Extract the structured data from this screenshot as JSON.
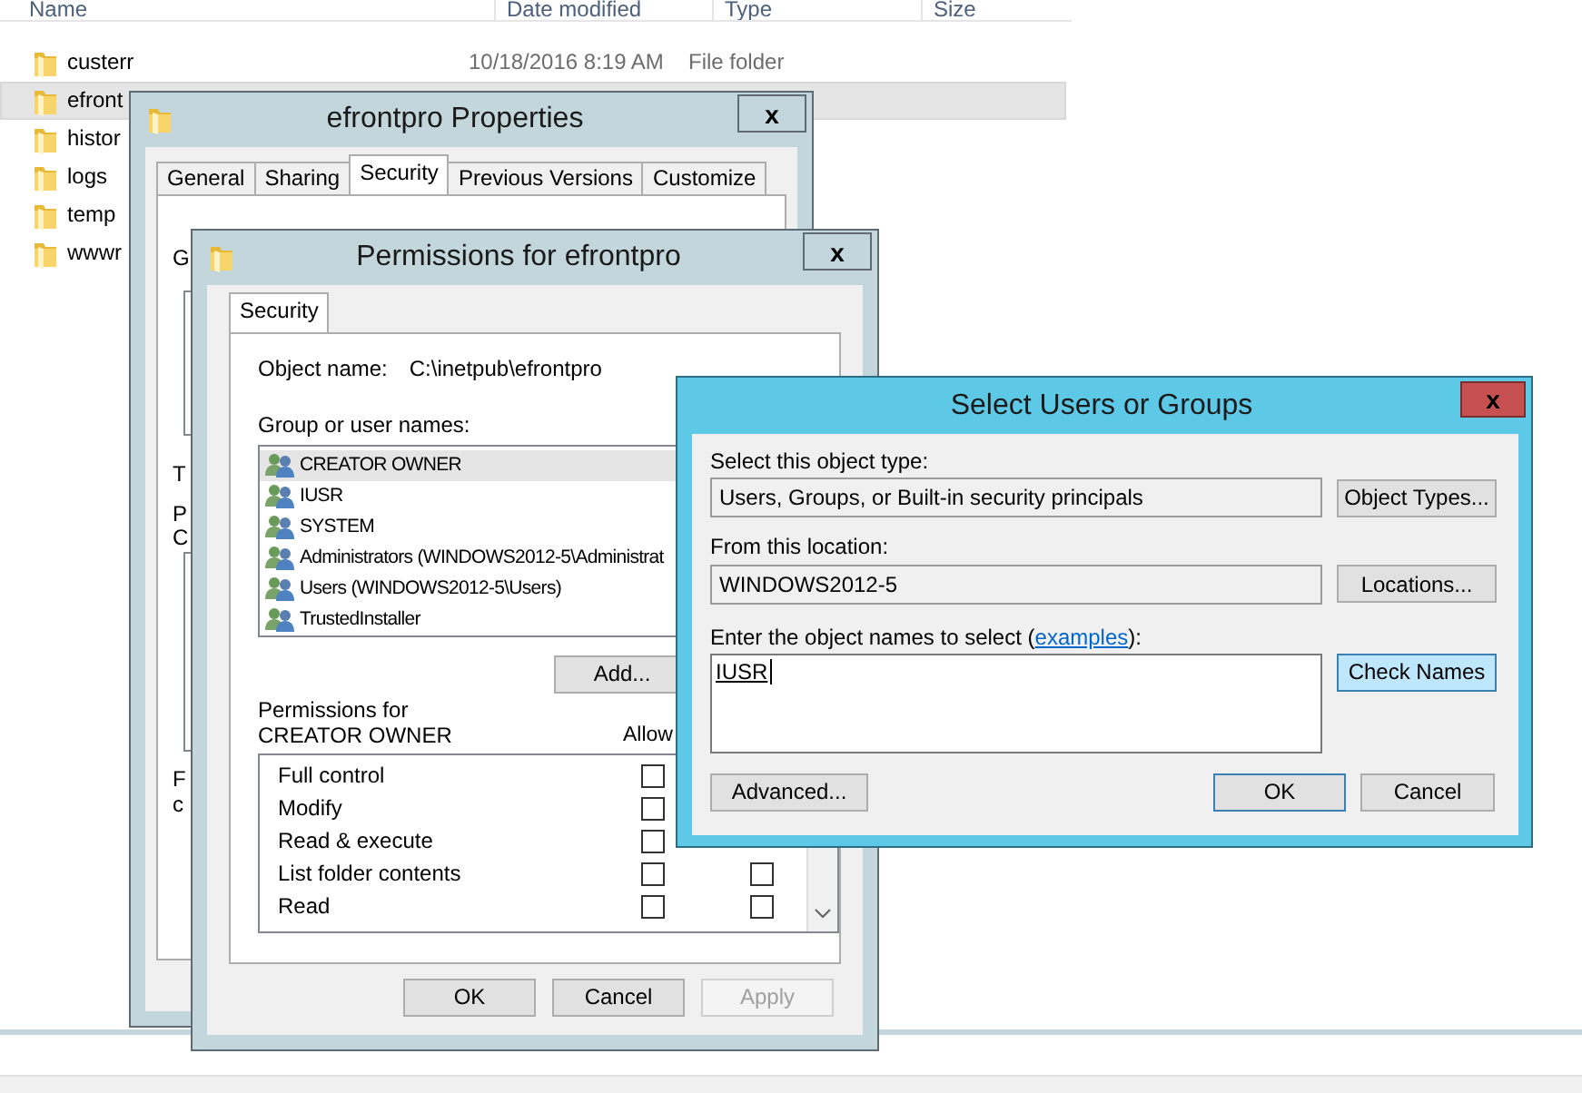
{
  "explorer": {
    "columns": [
      "Name",
      "Date modified",
      "Type",
      "Size"
    ],
    "rows": [
      {
        "name": "custerr",
        "date": "10/18/2016 8:19 AM",
        "type": "File folder",
        "selected": false
      },
      {
        "name": "efront",
        "selected": true
      },
      {
        "name": "histor",
        "selected": false
      },
      {
        "name": "logs",
        "selected": false
      },
      {
        "name": "temp",
        "selected": false
      },
      {
        "name": "wwwr",
        "selected": false
      }
    ]
  },
  "properties_window": {
    "title": "efrontpro Properties",
    "close": "x",
    "tabs": [
      {
        "label": "General",
        "selected": false
      },
      {
        "label": "Sharing",
        "selected": false
      },
      {
        "label": "Security",
        "selected": true
      },
      {
        "label": "Previous Versions",
        "selected": false
      },
      {
        "label": "Customize",
        "selected": false
      }
    ],
    "covered_letters": [
      "G",
      "T",
      "P",
      "C",
      "F",
      "c"
    ]
  },
  "permissions_window": {
    "title": "Permissions for efrontpro",
    "close": "x",
    "tabs": [
      {
        "label": "Security",
        "selected": true
      }
    ],
    "object_name_label": "Object name:",
    "object_name": "C:\\inetpub\\efrontpro",
    "group_label": "Group or user names:",
    "groups": [
      {
        "name": "CREATOR OWNER",
        "selected": true
      },
      {
        "name": "IUSR",
        "selected": false
      },
      {
        "name": "SYSTEM",
        "selected": false
      },
      {
        "name": "Administrators (WINDOWS2012-5\\Administrat",
        "selected": false
      },
      {
        "name": "Users (WINDOWS2012-5\\Users)",
        "selected": false
      },
      {
        "name": "TrustedInstaller",
        "selected": false
      }
    ],
    "add_button": "Add...",
    "permissions_label": "Permissions for CREATOR OWNER",
    "allow_header": "Allow",
    "permissions": [
      {
        "name": "Full control",
        "allow": false
      },
      {
        "name": "Modify",
        "allow": false
      },
      {
        "name": "Read & execute",
        "allow": false
      },
      {
        "name": "List folder contents",
        "allow": false,
        "deny": false
      },
      {
        "name": "Read",
        "allow": false,
        "deny": false
      }
    ],
    "buttons": [
      {
        "label": "OK",
        "disabled": false
      },
      {
        "label": "Cancel",
        "disabled": false
      },
      {
        "label": "Apply",
        "disabled": true
      }
    ]
  },
  "select_dialog": {
    "title": "Select Users or Groups",
    "close": "x",
    "type_label": "Select this object type:",
    "type_value": "Users, Groups, or Built-in security principals",
    "type_button": "Object Types...",
    "location_label": "From this location:",
    "location_value": "WINDOWS2012-5",
    "location_button": "Locations...",
    "names_label": "Enter the object names to select (",
    "names_link": "examples",
    "names_label_end": "):",
    "names_value": "IUSR",
    "check_button": "Check Names",
    "advanced_button": "Advanced...",
    "ok_button": "OK",
    "cancel_button": "Cancel"
  }
}
